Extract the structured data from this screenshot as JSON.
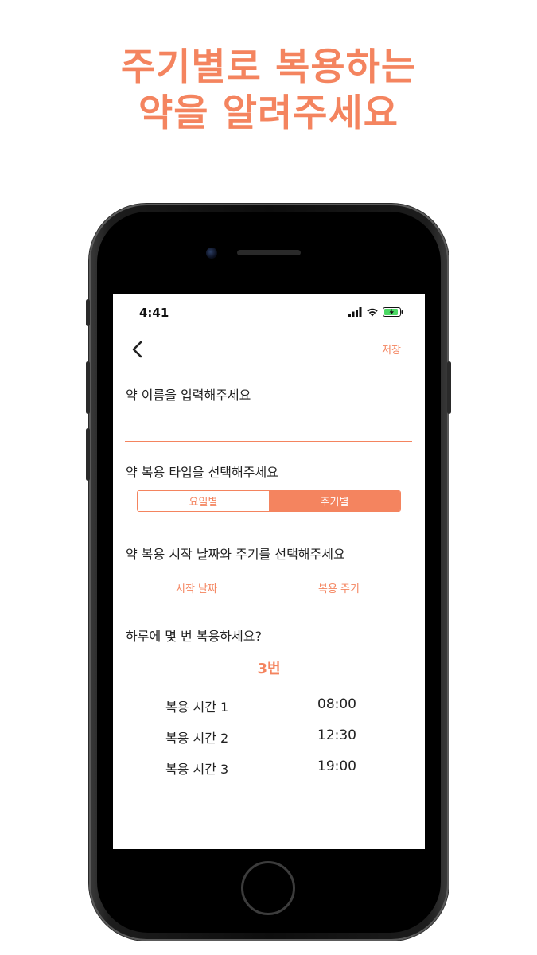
{
  "headline": {
    "line1": "주기별로 복용하는",
    "line2": "약을 알려주세요"
  },
  "status_bar": {
    "time": "4:41",
    "icons": [
      "cellular-signal-icon",
      "wifi-icon",
      "battery-charging-icon"
    ]
  },
  "nav": {
    "back_icon": "chevron-left-icon",
    "save_label": "저장"
  },
  "form": {
    "name_label": "약 이름을 입력해주세요",
    "name_value": "",
    "type_label": "약 복용 타입을 선택해주세요",
    "type_options": [
      "요일별",
      "주기별"
    ],
    "type_selected": "주기별",
    "start_cycle_label": "약 복용 시작 날짜와 주기를 선택해주세요",
    "start_date_label": "시작 날짜",
    "cycle_label": "복용 주기",
    "daily_count_label": "하루에 몇 번 복용하세요?",
    "daily_count_value": "3번",
    "doses": [
      {
        "label": "복용 시간 1",
        "time": "08:00"
      },
      {
        "label": "복용 시간 2",
        "time": "12:30"
      },
      {
        "label": "복용 시간 3",
        "time": "19:00"
      }
    ]
  },
  "colors": {
    "accent": "#F4845F",
    "text": "#222222",
    "phone_body": "#1a1a1a"
  }
}
